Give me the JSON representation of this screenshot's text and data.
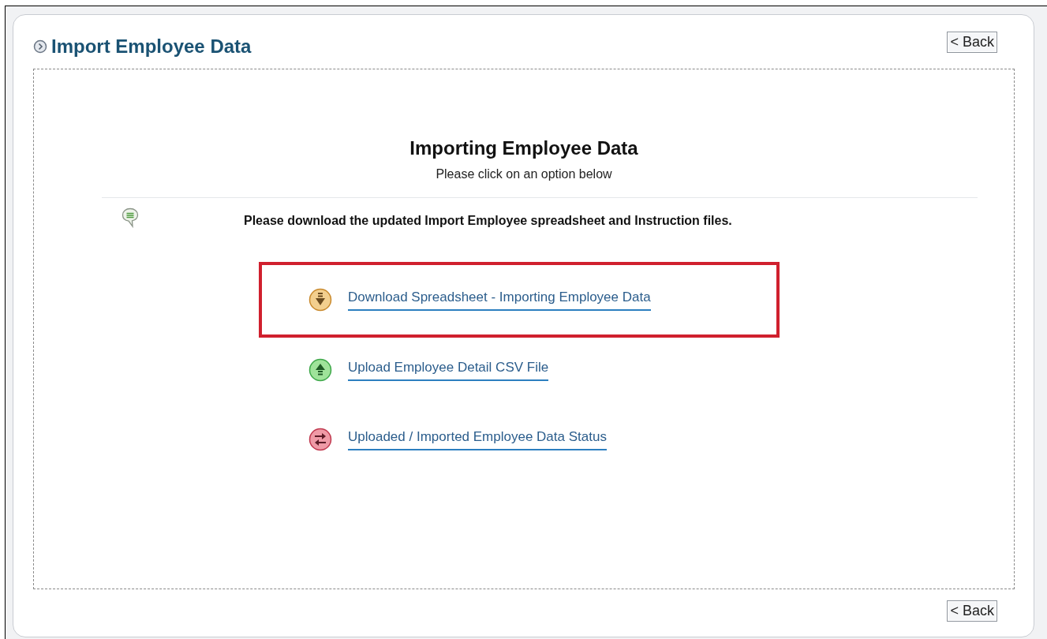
{
  "header": {
    "title": "Import Employee Data",
    "back_button": "< Back"
  },
  "heading": "Importing Employee Data",
  "subheading": "Please click on an option below",
  "note": "Please download the updated Import Employee spreadsheet and Instruction files.",
  "options": [
    {
      "kind": "download",
      "label": "Download Spreadsheet - Importing Employee Data",
      "highlighted": true
    },
    {
      "kind": "upload",
      "label": "Upload Employee Detail CSV File",
      "highlighted": false
    },
    {
      "kind": "status",
      "label": "Uploaded / Imported Employee Data Status",
      "highlighted": false
    }
  ],
  "footer": {
    "back_button": "< Back"
  }
}
